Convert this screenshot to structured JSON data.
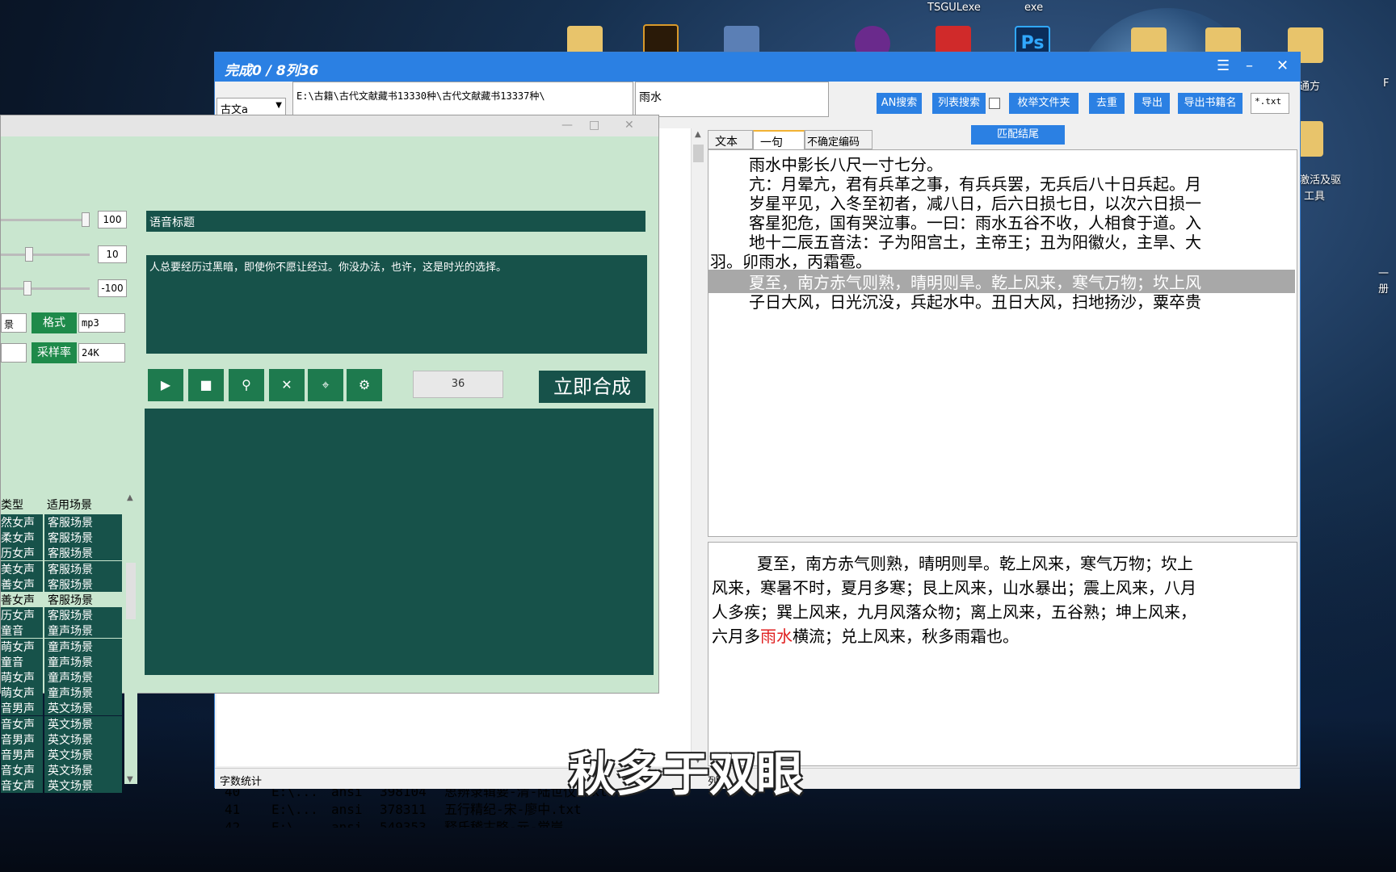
{
  "desktop": {
    "labels": [
      "TSGULexe",
      "exe",
      "通方",
      "F",
      "激活及驱",
      "工具",
      "一册"
    ]
  },
  "main": {
    "title": "完成0 / 8列36",
    "lang_combo": "古文a",
    "path": "E:\\古籍\\古代文献藏书13330种\\古代文献藏书13337种\\",
    "search_term": "雨水",
    "buttons": {
      "an_search": "AN搜索",
      "list_search": "列表搜索",
      "enum_folder": "枚举文件夹",
      "dedupe": "去重",
      "export": "导出",
      "export_titles": "导出书籍名",
      "ext_filter": "*.txt",
      "match_end": "匹配结尾"
    },
    "file_rows": [
      {
        "n": "40",
        "path": "E:\\...",
        "enc": "ansi",
        "size": "398104",
        "name": "思辨录辑要-清-陆世仪.txt"
      },
      {
        "n": "41",
        "path": "E:\\...",
        "enc": "ansi",
        "size": "378311",
        "name": "五行精纪-宋-廖中.txt"
      },
      {
        "n": "42",
        "path": "E:\\...",
        "enc": "ansi",
        "size": "549353",
        "name": "释氏稽古略-元-觉岸"
      }
    ],
    "tabs": [
      "文本",
      "一句",
      "不确定编码"
    ],
    "text_lines": [
      "雨水中影长八尺一寸七分。",
      "亢：月晕亢，君有兵革之事，有兵兵罢，无兵后八十日兵起。月",
      "岁星平见，入冬至初者，减八日，后六日损七日，以次六日损一",
      "客星犯危，国有哭泣事。一曰：雨水五谷不收，人相食于道。入",
      "地十二辰五音法：子为阳宫土，主帝王；丑为阳徽火，主旱、大",
      "羽。卯雨水，丙霜雹。",
      "夏至，南方赤气则熟，晴明则旱。乾上风来，寒气万物；坎上风",
      "子日大风，日光沉没，兵起水中。丑日大风，扫地扬沙，粟卒贵"
    ],
    "detail_lines": [
      {
        "pre": "夏至，南方赤气则熟，晴明则旱。乾上风来，寒气万物；坎上",
        "hl": "",
        "post": ""
      },
      {
        "pre": "风来，寒暑不时，夏月多寒；艮上风来，山水暴出；震上风来，八月",
        "hl": "",
        "post": ""
      },
      {
        "pre": "人多疾；巽上风来，九月风落众物；离上风来，五谷熟；坤上风来，",
        "hl": "",
        "post": ""
      },
      {
        "pre": "六月多",
        "hl": "雨水",
        "post": "横流；兑上风来，秋多雨霜也。"
      }
    ],
    "status_left": "字数统计",
    "status_mid": "列表"
  },
  "tts": {
    "sliders": [
      {
        "value": "100",
        "level": 1.0
      },
      {
        "value": "10",
        "level": 0.3
      },
      {
        "value": "-100",
        "level": 0.25
      }
    ],
    "title_field": "语音标题",
    "content_text": "人总要经历过黑暗，即使你不愿让经过。你没办法，也许，这是时光的选择。",
    "format_label": "格式",
    "format_value": "mp3",
    "rate_label": "采样率",
    "rate_value": "24K",
    "left_combo_1": "景",
    "count_value": "36",
    "synth_label": "立即合成",
    "voice_header": [
      "类型",
      "适用场景"
    ],
    "voices": [
      [
        "然女声",
        "客服场景"
      ],
      [
        "柔女声",
        "客服场景"
      ],
      [
        "历女声",
        "客服场景"
      ],
      [
        "美女声",
        "客服场景"
      ],
      [
        "善女声",
        "客服场景"
      ],
      [
        "善女声",
        "客服场景"
      ],
      [
        "历女声",
        "客服场景"
      ],
      [
        "童音",
        "童声场景"
      ],
      [
        "萌女声",
        "童声场景"
      ],
      [
        "童音",
        "童声场景"
      ],
      [
        "萌女声",
        "童声场景"
      ],
      [
        "萌女声",
        "童声场景"
      ],
      [
        "音男声",
        "英文场景"
      ],
      [
        "音女声",
        "英文场景"
      ],
      [
        "音男声",
        "英文场景"
      ],
      [
        "音男声",
        "英文场景"
      ],
      [
        "音女声",
        "英文场景"
      ],
      [
        "音女声",
        "英文场景"
      ]
    ]
  },
  "subtitle": "秋多于双眼"
}
